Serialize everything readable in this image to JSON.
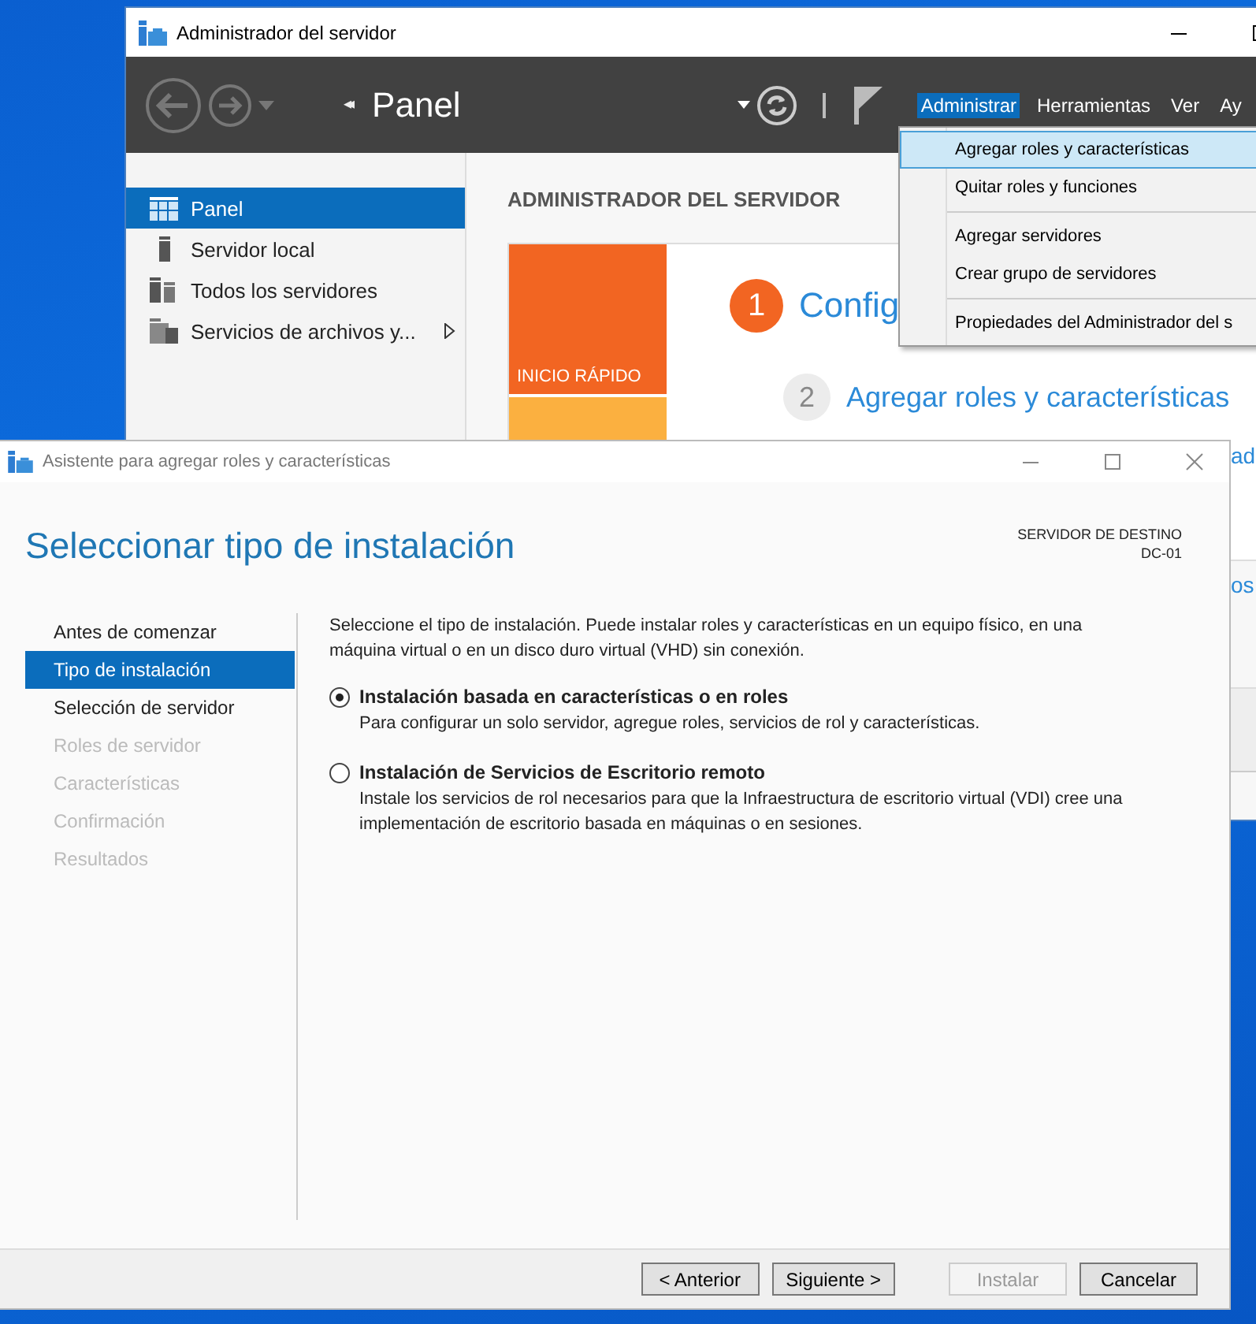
{
  "server_manager": {
    "title": "Administrador del servidor",
    "breadcrumb_marker": "◂◂",
    "page_title": "Panel",
    "menu": [
      {
        "label": "Administrar",
        "selected": true
      },
      {
        "label": "Herramientas",
        "selected": false
      },
      {
        "label": "Ver",
        "selected": false
      },
      {
        "label": "Ay",
        "selected": false
      }
    ],
    "dropdown": [
      [
        {
          "label": "Agregar roles y características",
          "selected": true
        },
        {
          "label": "Quitar roles y funciones",
          "selected": false
        }
      ],
      [
        {
          "label": "Agregar servidores",
          "selected": false
        },
        {
          "label": "Crear grupo de servidores",
          "selected": false
        }
      ],
      [
        {
          "label": "Propiedades del Administrador del s",
          "selected": false
        }
      ]
    ],
    "sidebar": [
      {
        "label": "Panel",
        "selected": true,
        "kind": "dashboard",
        "expandable": false
      },
      {
        "label": "Servidor local",
        "selected": false,
        "kind": "server",
        "expandable": false
      },
      {
        "label": "Todos los servidores",
        "selected": false,
        "kind": "servers",
        "expandable": false
      },
      {
        "label": "Servicios de archivos y...",
        "selected": false,
        "kind": "files",
        "expandable": true
      }
    ],
    "heading": "ADMINISTRADOR DEL SERVIDOR",
    "tile": "INICIO RÁPIDO",
    "steps": [
      {
        "number": "1",
        "label": "Config",
        "current": true
      },
      {
        "number": "2",
        "label": "Agregar roles y características",
        "current": false
      }
    ],
    "fragments": [
      "ad",
      "os"
    ]
  },
  "wizard": {
    "title": "Asistente para agregar roles y características",
    "heading": "Seleccionar tipo de instalación",
    "destination_label": "SERVIDOR DE DESTINO",
    "destination_server": "DC-01",
    "steps": [
      {
        "label": "Antes de comenzar",
        "selected": false,
        "disabled": false
      },
      {
        "label": "Tipo de instalación",
        "selected": true,
        "disabled": false
      },
      {
        "label": "Selección de servidor",
        "selected": false,
        "disabled": false
      },
      {
        "label": "Roles de servidor",
        "selected": false,
        "disabled": true
      },
      {
        "label": "Características",
        "selected": false,
        "disabled": true
      },
      {
        "label": "Confirmación",
        "selected": false,
        "disabled": true
      },
      {
        "label": "Resultados",
        "selected": false,
        "disabled": true
      }
    ],
    "intro": "Seleccione el tipo de instalación. Puede instalar roles y características en un equipo físico, en una máquina virtual o en un disco duro virtual (VHD) sin conexión.",
    "options": [
      {
        "label": "Instalación basada en características o en roles",
        "description": "Para configurar un solo servidor, agregue roles, servicios de rol y características.",
        "selected": true
      },
      {
        "label": "Instalación de Servicios de Escritorio remoto",
        "description": "Instale los servicios de rol necesarios para que la Infraestructura de escritorio virtual (VDI) cree una implementación de escritorio basada en máquinas o en sesiones.",
        "selected": false
      }
    ],
    "buttons": [
      {
        "label": "< Anterior",
        "disabled": false
      },
      {
        "label": "Siguiente >",
        "disabled": false
      },
      {
        "label": "Instalar",
        "disabled": true
      },
      {
        "label": "Cancelar",
        "disabled": false
      }
    ]
  }
}
